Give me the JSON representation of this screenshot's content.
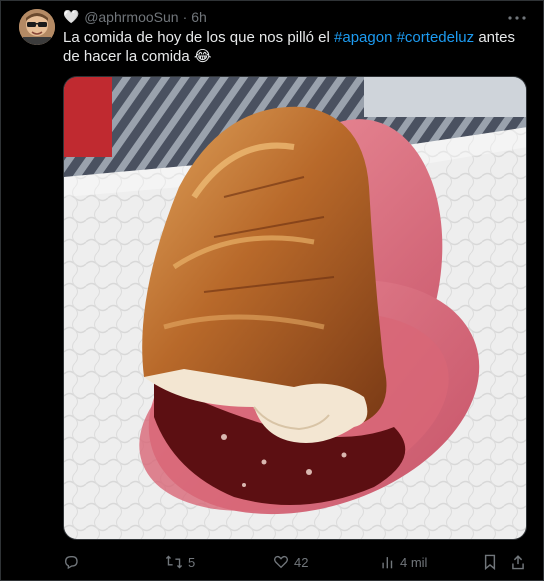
{
  "post": {
    "heart_emoji": "🤍",
    "handle": "@aphrmooSun",
    "separator": "·",
    "time": "6h",
    "text_plain_1": "La comida de hoy de los que nos pilló el ",
    "hashtag_1": "#apagon",
    "text_plain_2": " ",
    "hashtag_2": "#cortedeluz",
    "text_plain_3": " antes de hacer la comida ",
    "emoji": "😂"
  },
  "media": {
    "description_icon": "sandwich-photo"
  },
  "actions": {
    "reply_count": "",
    "repost_count": "5",
    "like_count": "42",
    "views_count": "4 mil"
  },
  "colors": {
    "background": "#000000",
    "text": "#e7e9ea",
    "muted": "#71767b",
    "link": "#1d9bf0",
    "border": "#2f3336"
  }
}
